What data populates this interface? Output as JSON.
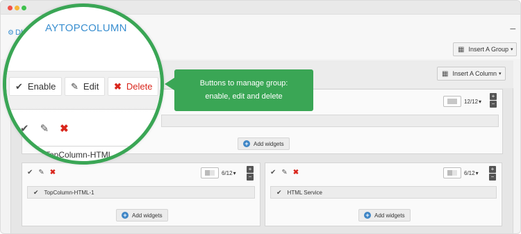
{
  "window": {
    "controls": [
      "close",
      "minimize",
      "maximize"
    ]
  },
  "module": {
    "title_short": "DI",
    "title_zoomed": "AYTOPCOLUMN",
    "gear_icon": "gear-icon",
    "collapse_icon": "minus-icon"
  },
  "toolbar": {
    "insert_group_label": "Insert A Group",
    "insert_column_label": "Insert A Column"
  },
  "magnifier": {
    "buttons": {
      "enable": "Enable",
      "edit": "Edit",
      "delete": "Delete"
    },
    "column_label": "TopColumn-HTML-"
  },
  "callout": {
    "line1": "Buttons to manage group:",
    "line2": "enable, edit and delete"
  },
  "columns": {
    "top": {
      "size_label": "12/12",
      "add_label": "Add widgets"
    },
    "left": {
      "size_label": "6/12",
      "widget": "TopColumn-HTML-1",
      "add_label": "Add widgets"
    },
    "right": {
      "size_label": "6/12",
      "widget": "HTML Service",
      "add_label": "Add widgets"
    }
  },
  "colors": {
    "accent_green": "#3aa655",
    "link_blue": "#3a8fd0",
    "delete_red": "#d9261c"
  }
}
